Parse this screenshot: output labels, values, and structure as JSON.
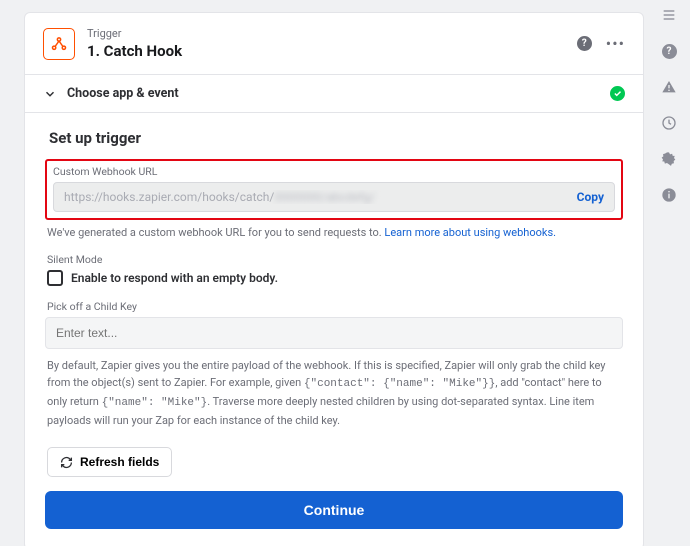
{
  "header": {
    "overline": "Trigger",
    "title": "1. Catch Hook"
  },
  "section": {
    "choose_label": "Choose app & event"
  },
  "setup": {
    "title": "Set up trigger",
    "webhook_label": "Custom Webhook URL",
    "webhook_url_prefix": "https://hooks.zapier.com/hooks/catch/",
    "webhook_url_blur": "0000000/abcdefg/",
    "copy_label": "Copy",
    "helper_before": "We've generated a custom webhook URL for you to send requests to. ",
    "helper_link": "Learn more about using webhooks.",
    "silent_label": "Silent Mode",
    "silent_checkbox_label": "Enable to respond with an empty body.",
    "childkey_label": "Pick off a Child Key",
    "childkey_placeholder": "Enter text...",
    "desc_1": "By default, Zapier gives you the entire payload of the webhook. If this is specified, Zapier will only grab the child key from the object(s) sent to Zapier. For example, given ",
    "desc_code1": "{\"contact\": {\"name\": \"Mike\"}}",
    "desc_2": ", add \"contact\" here to only return ",
    "desc_code2": "{\"name\": \"Mike\"}",
    "desc_3": ". Traverse more deeply nested children by using dot-separated syntax. Line item payloads will run your Zap for each instance of the child key.",
    "refresh_label": "Refresh fields",
    "continue_label": "Continue"
  }
}
